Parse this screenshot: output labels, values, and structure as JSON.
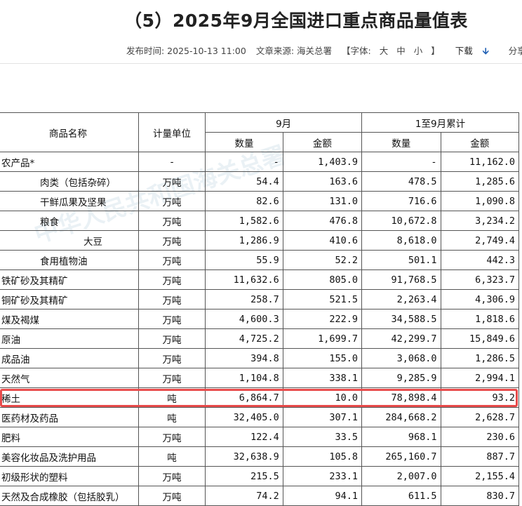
{
  "page": {
    "title": "（5）2025年9月全国进口重点商品量值表",
    "publish_time": "发布时间: 2025-10-13 11:00",
    "source": "文章来源: 海关总署",
    "font_label": "【字体:",
    "font_sizes": [
      "大",
      "中",
      "小"
    ],
    "font_close": "】",
    "download": "下载",
    "share": "分享"
  },
  "table": {
    "headers": {
      "name": "商品名称",
      "unit": "计量单位",
      "month": "9月",
      "cumulative": "1至9月累计",
      "qty": "数量",
      "amount": "金额"
    },
    "rows": [
      {
        "name": "农产品*",
        "unit": "-",
        "m_qty": "-",
        "m_amt": "1,403.9",
        "c_qty": "-",
        "c_amt": "11,162.0",
        "indent": 0
      },
      {
        "name": "肉类（包括杂碎）",
        "unit": "万吨",
        "m_qty": "54.4",
        "m_amt": "163.6",
        "c_qty": "478.5",
        "c_amt": "1,285.6",
        "indent": 1
      },
      {
        "name": "干鲜瓜果及坚果",
        "unit": "万吨",
        "m_qty": "82.6",
        "m_amt": "131.0",
        "c_qty": "716.6",
        "c_amt": "1,090.8",
        "indent": 1
      },
      {
        "name": "粮食",
        "unit": "万吨",
        "m_qty": "1,582.6",
        "m_amt": "476.8",
        "c_qty": "10,672.8",
        "c_amt": "3,234.2",
        "indent": 1
      },
      {
        "name": "大豆",
        "unit": "万吨",
        "m_qty": "1,286.9",
        "m_amt": "410.6",
        "c_qty": "8,618.0",
        "c_amt": "2,749.4",
        "indent": 2
      },
      {
        "name": "食用植物油",
        "unit": "万吨",
        "m_qty": "55.9",
        "m_amt": "52.2",
        "c_qty": "501.1",
        "c_amt": "442.3",
        "indent": 1
      },
      {
        "name": "铁矿砂及其精矿",
        "unit": "万吨",
        "m_qty": "11,632.6",
        "m_amt": "805.0",
        "c_qty": "91,768.5",
        "c_amt": "6,323.7",
        "indent": 0
      },
      {
        "name": "铜矿砂及其精矿",
        "unit": "万吨",
        "m_qty": "258.7",
        "m_amt": "521.5",
        "c_qty": "2,263.4",
        "c_amt": "4,306.9",
        "indent": 0
      },
      {
        "name": "煤及褐煤",
        "unit": "万吨",
        "m_qty": "4,600.3",
        "m_amt": "222.9",
        "c_qty": "34,588.5",
        "c_amt": "1,818.6",
        "indent": 0
      },
      {
        "name": "原油",
        "unit": "万吨",
        "m_qty": "4,725.2",
        "m_amt": "1,699.7",
        "c_qty": "42,299.7",
        "c_amt": "15,849.6",
        "indent": 0
      },
      {
        "name": "成品油",
        "unit": "万吨",
        "m_qty": "394.8",
        "m_amt": "155.0",
        "c_qty": "3,068.0",
        "c_amt": "1,286.5",
        "indent": 0
      },
      {
        "name": "天然气",
        "unit": "万吨",
        "m_qty": "1,104.8",
        "m_amt": "338.1",
        "c_qty": "9,285.9",
        "c_amt": "2,994.1",
        "indent": 0
      },
      {
        "name": "稀土",
        "unit": "吨",
        "m_qty": "6,864.7",
        "m_amt": "10.0",
        "c_qty": "78,898.4",
        "c_amt": "93.2",
        "indent": 0
      },
      {
        "name": "医药材及药品",
        "unit": "吨",
        "m_qty": "32,405.0",
        "m_amt": "307.1",
        "c_qty": "284,668.2",
        "c_amt": "2,628.7",
        "indent": 0
      },
      {
        "name": "肥料",
        "unit": "万吨",
        "m_qty": "122.4",
        "m_amt": "33.5",
        "c_qty": "968.1",
        "c_amt": "230.6",
        "indent": 0
      },
      {
        "name": "美容化妆品及洗护用品",
        "unit": "吨",
        "m_qty": "32,638.9",
        "m_amt": "105.8",
        "c_qty": "265,160.7",
        "c_amt": "887.7",
        "indent": 0
      },
      {
        "name": "初级形状的塑料",
        "unit": "万吨",
        "m_qty": "215.5",
        "m_amt": "233.1",
        "c_qty": "2,007.0",
        "c_amt": "2,155.4",
        "indent": 0
      },
      {
        "name": "天然及合成橡胶（包括胶乳）",
        "unit": "万吨",
        "m_qty": "74.2",
        "m_amt": "94.1",
        "c_qty": "611.5",
        "c_amt": "830.7",
        "indent": 0
      }
    ]
  },
  "colors": {
    "highlight": "#e84b4b",
    "download_icon": "#1e5fb3"
  }
}
